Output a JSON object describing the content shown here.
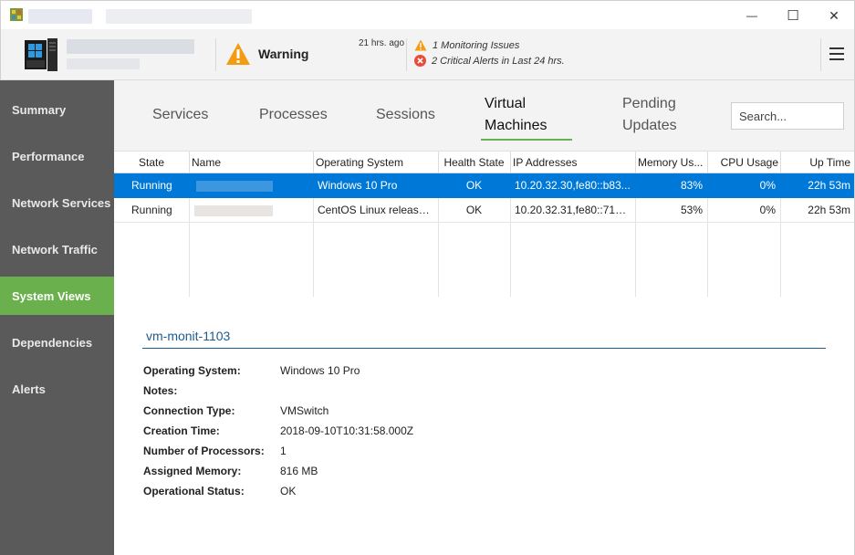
{
  "window": {
    "controls": {
      "minimize": "—",
      "maximize": "☐",
      "close": "✕"
    }
  },
  "header": {
    "status_label": "Warning",
    "status_time": "21 hrs. ago",
    "issues": [
      {
        "icon": "warning-triangle-icon",
        "text": "1 Monitoring Issues"
      },
      {
        "icon": "critical-x-icon",
        "text": "2 Critical Alerts in Last 24 hrs."
      }
    ],
    "colors": {
      "warning": "#f39c12",
      "critical": "#e74c3c"
    }
  },
  "sidebar": {
    "items": [
      {
        "label": "Summary"
      },
      {
        "label": "Performance"
      },
      {
        "label": "Network Services"
      },
      {
        "label": "Network Traffic"
      },
      {
        "label": "System Views"
      },
      {
        "label": "Dependencies"
      },
      {
        "label": "Alerts"
      }
    ],
    "active_index": 4,
    "active_color": "#6ab04c"
  },
  "tabs": [
    {
      "label": "Services"
    },
    {
      "label": "Processes"
    },
    {
      "label": "Sessions"
    },
    {
      "label": "Virtual Machines",
      "line1": "Virtual",
      "line2": "Machines"
    },
    {
      "label": "Pending Updates",
      "line1": "Pending",
      "line2": "Updates"
    }
  ],
  "search": {
    "placeholder": "Search..."
  },
  "grid": {
    "columns": [
      "State",
      "Name",
      "Operating System",
      "Health State",
      "IP Addresses",
      "Memory Us...",
      "CPU Usage",
      "Up Time"
    ],
    "rows": [
      {
        "state": "Running",
        "os": "Windows 10 Pro",
        "health": "OK",
        "ip": "10.20.32.30,fe80::b83...",
        "memory": "83%",
        "cpu": "0%",
        "uptime": "22h 53m"
      },
      {
        "state": "Running",
        "os": "CentOS Linux release ...",
        "health": "OK",
        "ip": "10.20.32.31,fe80::71c6...",
        "memory": "53%",
        "cpu": "0%",
        "uptime": "22h 53m"
      }
    ],
    "selected_color": "#0078d7"
  },
  "details": {
    "title": "vm-monit-1103",
    "properties": [
      {
        "label": "Operating System:",
        "value": "Windows 10 Pro"
      },
      {
        "label": "Notes:",
        "value": ""
      },
      {
        "label": "Connection Type:",
        "value": "VMSwitch"
      },
      {
        "label": "Creation Time:",
        "value": "2018-09-10T10:31:58.000Z"
      },
      {
        "label": "Number of Processors:",
        "value": "1"
      },
      {
        "label": "Assigned Memory:",
        "value": "816 MB"
      },
      {
        "label": "Operational Status:",
        "value": "OK"
      }
    ]
  }
}
